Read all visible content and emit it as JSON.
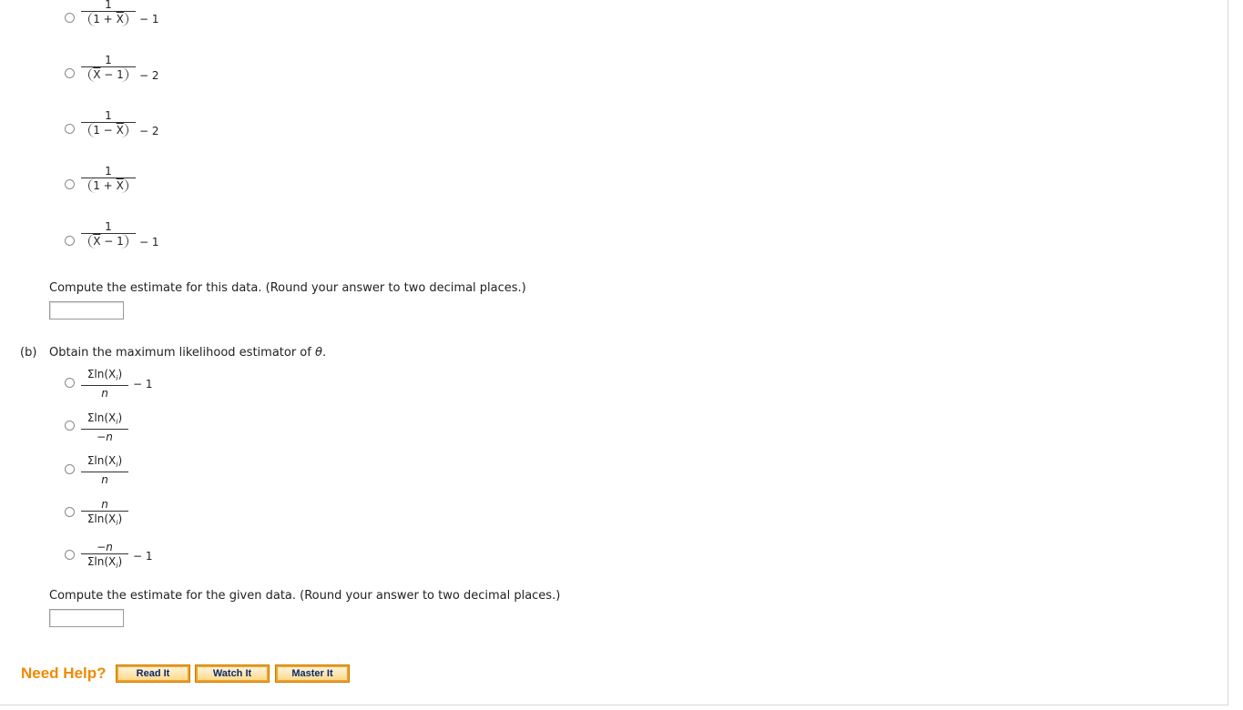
{
  "part_a": {
    "options": [
      {
        "num": "1",
        "den_left": "1",
        "den_op": "+",
        "den_right": "X",
        "den_right_bar": true,
        "suffix": "− 1"
      },
      {
        "num": "1",
        "den_left": "X",
        "den_left_bar": true,
        "den_op": "−",
        "den_right": "1",
        "suffix": "− 2"
      },
      {
        "num": "1",
        "den_left": "1",
        "den_op": "−",
        "den_right": "X",
        "den_right_bar": true,
        "suffix": "− 2"
      },
      {
        "num": "1",
        "den_left": "1",
        "den_op": "+",
        "den_right": "X",
        "den_right_bar": true,
        "suffix": ""
      },
      {
        "num": "1",
        "den_left": "X",
        "den_left_bar": true,
        "den_op": "−",
        "den_right": "1",
        "suffix": "− 1"
      }
    ],
    "compute_prompt": "Compute the estimate for this data. (Round your answer to two decimal places.)",
    "answer_value": ""
  },
  "part_b": {
    "label": "(b)",
    "question_prefix": "Obtain the maximum likelihood estimator of ",
    "question_symbol": "θ",
    "question_suffix": ".",
    "options": [
      {
        "num": "Σln(X",
        "num_sub": "i",
        "num_close": ")",
        "den": "n",
        "suffix": "− 1"
      },
      {
        "num": "Σln(X",
        "num_sub": "i",
        "num_close": ")",
        "den": "−n",
        "suffix": ""
      },
      {
        "num": "Σln(X",
        "num_sub": "i",
        "num_close": ")",
        "den": "n",
        "suffix": ""
      },
      {
        "num": "n",
        "den": "Σln(X",
        "den_sub": "i",
        "den_close": ")",
        "suffix": ""
      },
      {
        "num": "−n",
        "den": "Σln(X",
        "den_sub": "i",
        "den_close": ")",
        "suffix": "− 1"
      }
    ],
    "compute_prompt": "Compute the estimate for the given data. (Round your answer to two decimal places.)",
    "answer_value": ""
  },
  "help": {
    "title": "Need Help?",
    "buttons": [
      "Read It",
      "Watch It",
      "Master It"
    ]
  },
  "colors": {
    "help_title": "#f08a00",
    "button_bg": "#f7a500",
    "button_text": "#0b2a6b"
  }
}
